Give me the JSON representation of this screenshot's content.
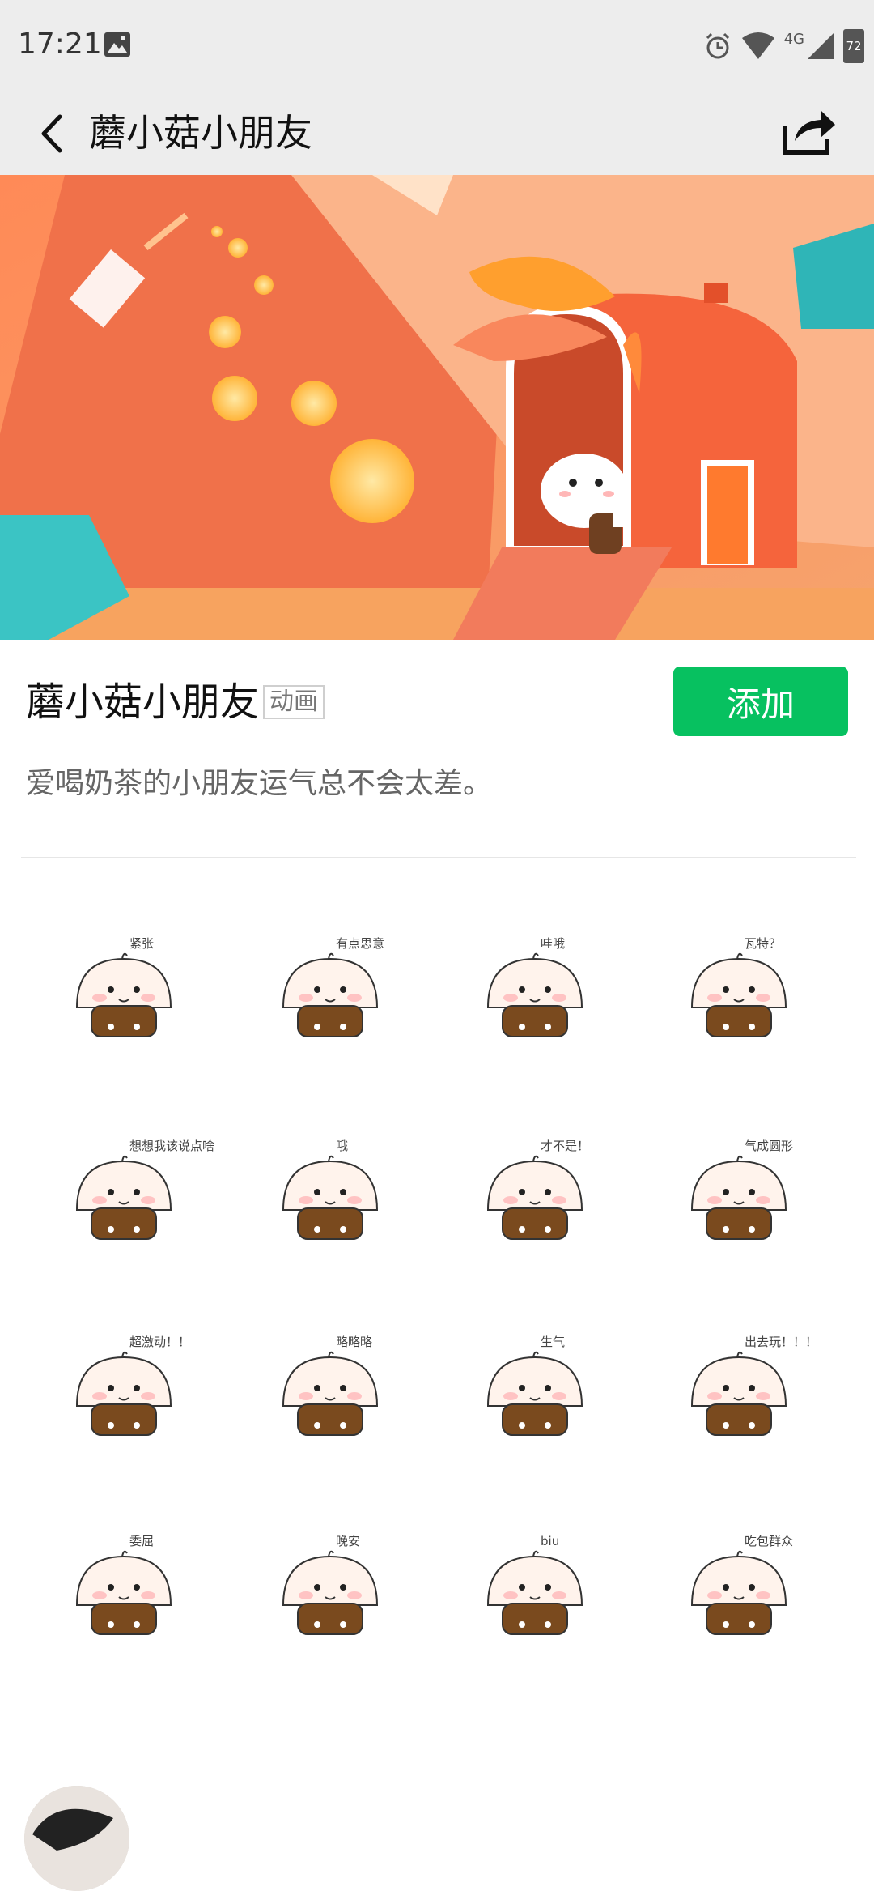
{
  "status": {
    "time": "17:21",
    "network": "4G",
    "battery": "72"
  },
  "nav": {
    "title": "蘑小菇小朋友",
    "back_icon": "back-arrow-icon",
    "share_icon": "share-icon"
  },
  "sticker_pack": {
    "name": "蘑小菇小朋友",
    "tag": "动画",
    "add_label": "添加",
    "description": "爱喝奶茶的小朋友运气总不会太差。"
  },
  "stickers": [
    {
      "caption": "紧张"
    },
    {
      "caption": "有点思意"
    },
    {
      "caption": "哇哦"
    },
    {
      "caption": "瓦特？"
    },
    {
      "caption": "想想我该说点啥"
    },
    {
      "caption": "哦"
    },
    {
      "caption": "才不是！"
    },
    {
      "caption": "气成圆形"
    },
    {
      "caption": "超激动！！"
    },
    {
      "caption": "略略略"
    },
    {
      "caption": "生气"
    },
    {
      "caption": "出去玩！！！"
    },
    {
      "caption": "委屈"
    },
    {
      "caption": "晚安"
    },
    {
      "caption": "biu"
    },
    {
      "caption": "吃包群众"
    }
  ],
  "colors": {
    "accent": "#07c160",
    "banner_orange": "#f57b4a",
    "mushroom_cap": "#fff3ec",
    "mushroom_stem": "#7a4a1e"
  }
}
